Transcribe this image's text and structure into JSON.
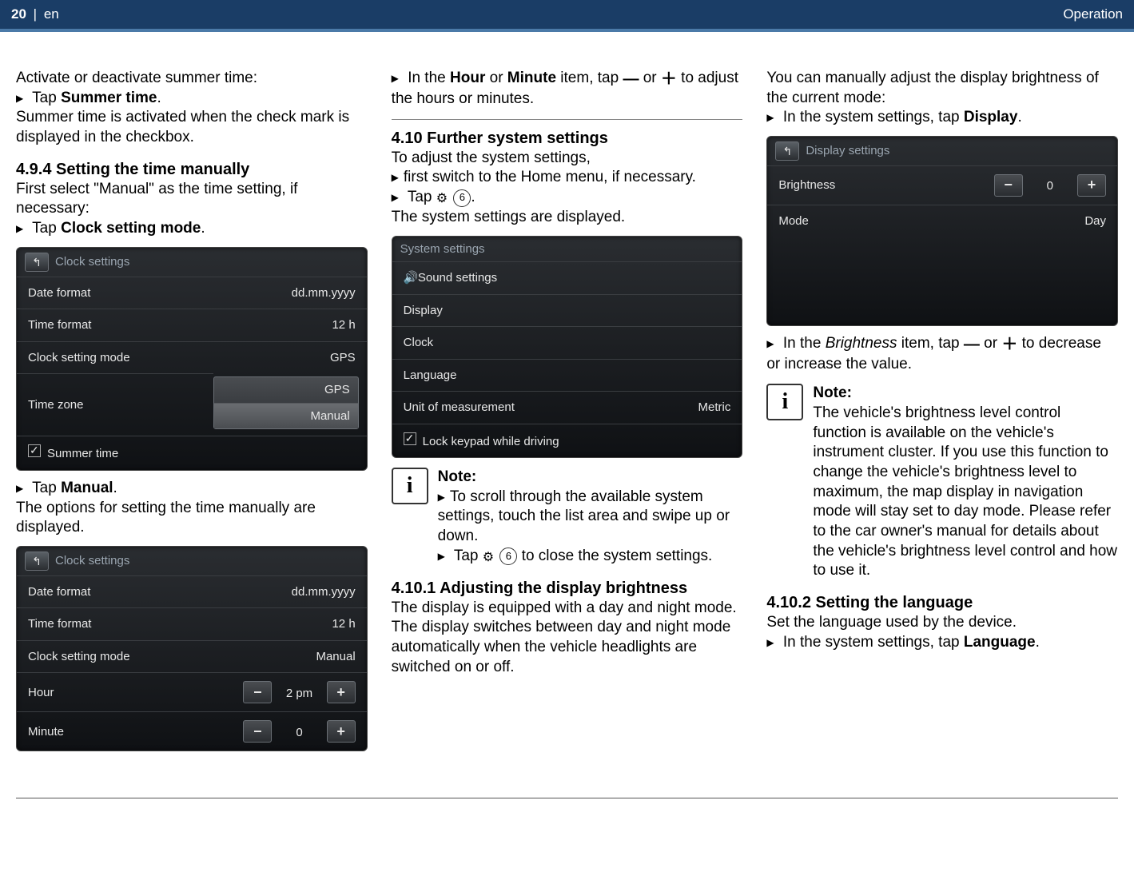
{
  "header": {
    "page": "20",
    "lang_sep": "|",
    "lang": "en",
    "section": "Operation"
  },
  "col1": {
    "p1": "Activate or deactivate summer time:",
    "b1_pre": "Tap ",
    "b1_bold": "Summer time",
    "b1_post": ".",
    "p2": "Summer time is activated when the check mark is displayed in the checkbox.",
    "h494": "4.9.4   Setting the time manually",
    "p3": "First select \"Manual\" as the time setting, if necessary:",
    "b2_pre": "Tap ",
    "b2_bold": "Clock setting mode",
    "b2_post": ".",
    "panel1": {
      "title": "Clock settings",
      "rows": {
        "dateformat_l": "Date format",
        "dateformat_v": "dd.mm.yyyy",
        "timeformat_l": "Time format",
        "timeformat_v": "12 h",
        "csm_l": "Clock setting mode",
        "csm_v": "GPS",
        "tz_l": "Time zone",
        "st_l": "Summer time"
      },
      "dd": {
        "opt1": "GPS",
        "opt2": "Manual"
      }
    },
    "b3_pre": "Tap ",
    "b3_bold": "Manual",
    "b3_post": ".",
    "p4": "The options for setting the time manually are displayed.",
    "panel2": {
      "title": "Clock settings",
      "rows": {
        "dateformat_l": "Date format",
        "dateformat_v": "dd.mm.yyyy",
        "timeformat_l": "Time format",
        "timeformat_v": "12 h",
        "csm_l": "Clock setting mode",
        "csm_v": "Manual",
        "hour_l": "Hour",
        "hour_v": "2 pm",
        "minute_l": "Minute",
        "minute_v": "0"
      }
    }
  },
  "col2": {
    "b1_pre": "In the ",
    "b1_bold1": "Hour",
    "b1_mid1": " or ",
    "b1_bold2": "Minute",
    "b1_mid2": " item, tap ",
    "b1_mid3": " or ",
    "b1_post": " to adjust the hours or minutes.",
    "h410": "4.10 Further system settings",
    "p1": "To adjust the system settings,",
    "b2": "first switch to the Home menu, if necessary.",
    "b3_pre": "Tap ",
    "b3_num": "6",
    "b3_post": ".",
    "p2": "The system settings are displayed.",
    "panel": {
      "title": "System settings",
      "rows": {
        "sound": "Sound settings",
        "display": "Display",
        "clock": "Clock",
        "language": "Language",
        "uom_l": "Unit of measurement",
        "uom_v": "Metric",
        "lock": "Lock keypad while driving"
      }
    },
    "note_title": "Note:",
    "note_b1": "To scroll through the available system settings, touch the list area and swipe up or down.",
    "note_b2_pre": "Tap ",
    "note_b2_num": "6",
    "note_b2_post": " to close the system settings.",
    "h4101": "4.10.1 Adjusting the display brightness",
    "p3": "The display is equipped with a day and night mode. The display switches between day and night mode automatically when the vehicle headlights are switched on or off."
  },
  "col3": {
    "p1": "You can manually adjust the display brightness of the current mode:",
    "b1_pre": "In the system settings, tap ",
    "b1_bold": "Display",
    "b1_post": ".",
    "panel": {
      "title": "Display settings",
      "rows": {
        "brightness_l": "Brightness",
        "brightness_v": "0",
        "mode_l": "Mode",
        "mode_v": "Day"
      }
    },
    "b2_pre": "In the ",
    "b2_it": "Brightness",
    "b2_mid1": " item, tap ",
    "b2_mid2": " or ",
    "b2_post": " to decrease or increase the value.",
    "note_title": "Note:",
    "note_body": "The vehicle's brightness level control function is available on the vehicle's instrument cluster. If you use this function to change the vehicle's brightness level to maximum, the map display in navigation mode will stay set to day mode. Please refer to the car owner's manual for details about the vehicle's brightness level control and how to use it.",
    "h4102": "4.10.2 Setting the language",
    "p2": "Set the language used by the device.",
    "b3_pre": "In the system settings, tap ",
    "b3_bold": "Language",
    "b3_post": "."
  }
}
